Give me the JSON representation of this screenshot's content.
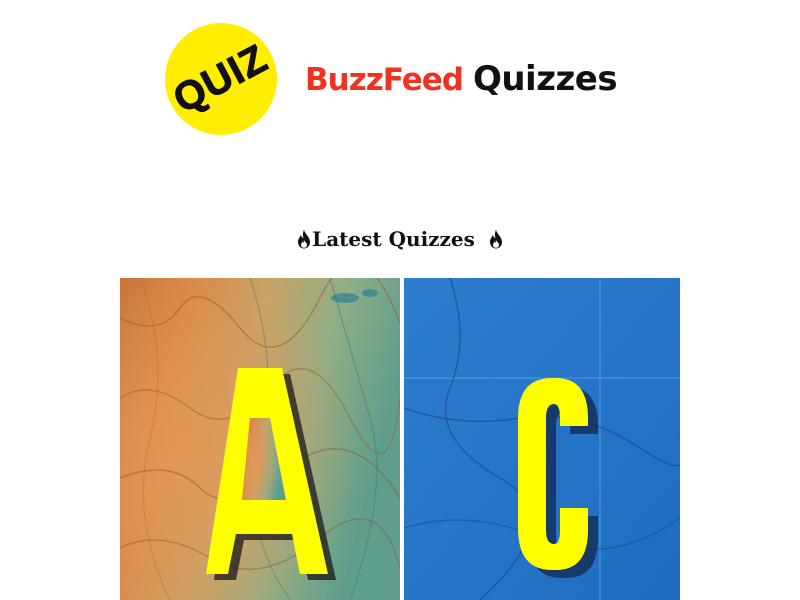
{
  "header": {
    "badge_text": "QUIZ",
    "brand_name": "BuzzFeed",
    "brand_suffix": "Quizzes",
    "badge_color": "#ffee00",
    "brand_color": "#ee3322"
  },
  "section": {
    "title": "Latest Quizzes",
    "icon": "fire-icon"
  },
  "quiz": {
    "image_letters": [
      "A",
      "C"
    ],
    "letter_color": "#ffff00"
  }
}
